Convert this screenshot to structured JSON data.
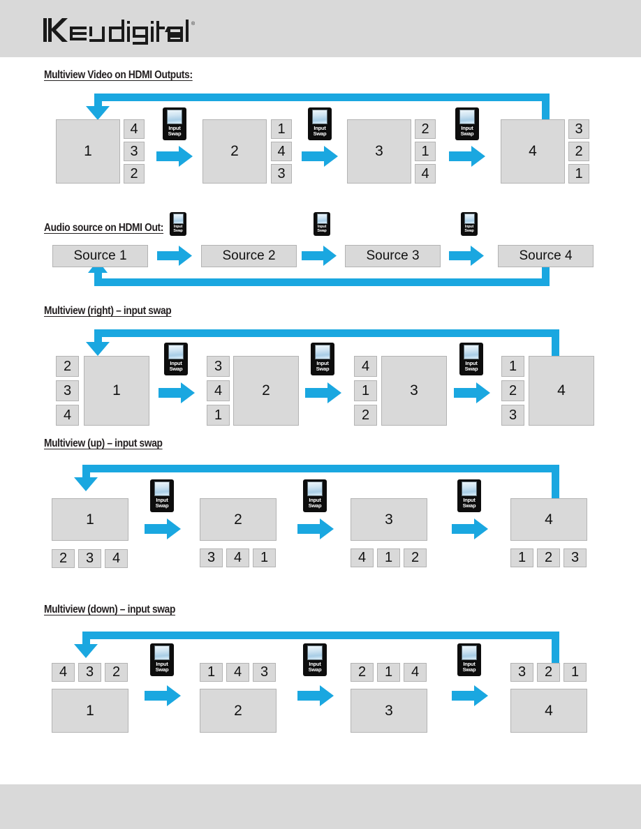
{
  "brand": {
    "name": "Key digital",
    "trademark": "®"
  },
  "sections": [
    {
      "id": "multiview-video",
      "title": "Multiview Video on HDMI Outputs:",
      "layout": "big-left-small-right",
      "swap_label_line1": "Input",
      "swap_label_line2": "Swap",
      "steps": [
        {
          "main": "1",
          "side": [
            "4",
            "3",
            "2"
          ]
        },
        {
          "main": "2",
          "side": [
            "1",
            "4",
            "3"
          ]
        },
        {
          "main": "3",
          "side": [
            "2",
            "1",
            "4"
          ]
        },
        {
          "main": "4",
          "side": [
            "3",
            "2",
            "1"
          ]
        }
      ]
    },
    {
      "id": "audio-source",
      "title": "Audio source on HDMI Out:",
      "layout": "single-bar",
      "swap_label_line1": "Input",
      "swap_label_line2": "Swap",
      "steps": [
        {
          "main": "Source 1"
        },
        {
          "main": "Source 2"
        },
        {
          "main": "Source 3"
        },
        {
          "main": "Source 4"
        }
      ]
    },
    {
      "id": "multiview-right",
      "title": "Multiview (right) – input swap",
      "layout": "small-left-big-right",
      "swap_label_line1": "Input",
      "swap_label_line2": "Swap",
      "steps": [
        {
          "main": "1",
          "side": [
            "2",
            "3",
            "4"
          ]
        },
        {
          "main": "2",
          "side": [
            "3",
            "4",
            "1"
          ]
        },
        {
          "main": "3",
          "side": [
            "4",
            "1",
            "2"
          ]
        },
        {
          "main": "4",
          "side": [
            "1",
            "2",
            "3"
          ]
        }
      ]
    },
    {
      "id": "multiview-up",
      "title": "Multiview (up) – input swap",
      "layout": "big-top-small-bottom",
      "swap_label_line1": "Input",
      "swap_label_line2": "Swap",
      "steps": [
        {
          "main": "1",
          "side": [
            "2",
            "3",
            "4"
          ]
        },
        {
          "main": "2",
          "side": [
            "3",
            "4",
            "1"
          ]
        },
        {
          "main": "3",
          "side": [
            "4",
            "1",
            "2"
          ]
        },
        {
          "main": "4",
          "side": [
            "1",
            "2",
            "3"
          ]
        }
      ]
    },
    {
      "id": "multiview-down",
      "title": "Multiview (down) – input swap",
      "layout": "small-top-big-bottom",
      "swap_label_line1": "Input",
      "swap_label_line2": "Swap",
      "steps": [
        {
          "main": "1",
          "side": [
            "4",
            "3",
            "2"
          ]
        },
        {
          "main": "2",
          "side": [
            "1",
            "4",
            "3"
          ]
        },
        {
          "main": "3",
          "side": [
            "2",
            "1",
            "4"
          ]
        },
        {
          "main": "4",
          "side": [
            "3",
            "2",
            "1"
          ]
        }
      ]
    }
  ],
  "colors": {
    "accent_blue": "#1aa7e0",
    "tile_fill": "#d9d9d9",
    "tile_border": "#b3b3b3",
    "band_gray": "#d9d9d9",
    "text": "#231f20"
  }
}
